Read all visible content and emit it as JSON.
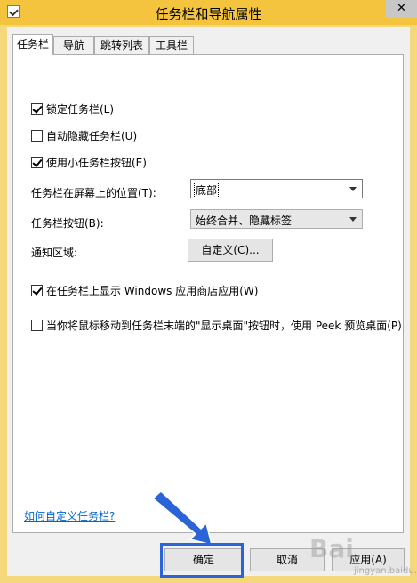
{
  "window": {
    "title": "任务栏和导航属性",
    "close_glyph": "✕"
  },
  "tabs": [
    {
      "label": "任务栏",
      "active": true
    },
    {
      "label": "导航",
      "active": false
    },
    {
      "label": "跳转列表",
      "active": false
    },
    {
      "label": "工具栏",
      "active": false
    }
  ],
  "options": {
    "lock_taskbar": {
      "label": "锁定任务栏(L)",
      "checked": true
    },
    "auto_hide": {
      "label": "自动隐藏任务栏(U)",
      "checked": false
    },
    "small_buttons": {
      "label": "使用小任务栏按钮(E)",
      "checked": true
    },
    "position_label": "任务栏在屏幕上的位置(T):",
    "position_value": "底部",
    "buttons_label": "任务栏按钮(B):",
    "buttons_value": "始终合并、隐藏标签",
    "notify_label": "通知区域:",
    "customize_button": "自定义(C)...",
    "show_store_apps": {
      "label": "在任务栏上显示 Windows 应用商店应用(W)",
      "checked": true
    },
    "peek": {
      "label": "当你将鼠标移动到任务栏末端的\"显示桌面\"按钮时，使用 Peek 预览桌面(P)",
      "checked": false
    }
  },
  "help_link": "如何自定义任务栏?",
  "buttons": {
    "ok": "确定",
    "cancel": "取消",
    "apply": "应用(A)"
  },
  "annotation": {
    "color": "#2b63d8"
  },
  "watermark": {
    "text": "Bai",
    "sub": "jingyan.baidu.com"
  }
}
